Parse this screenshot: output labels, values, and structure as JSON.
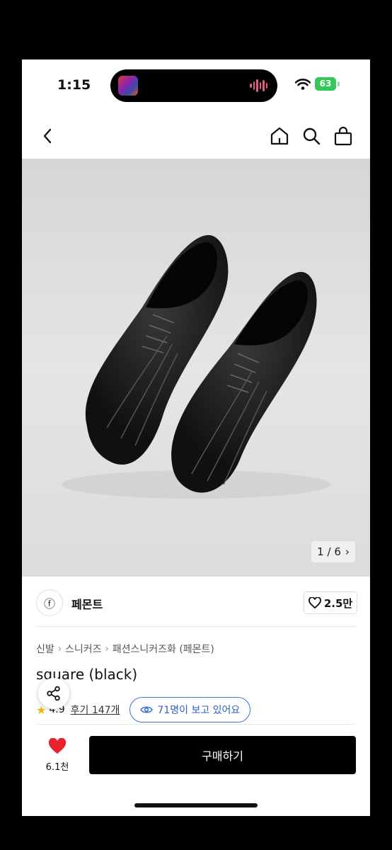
{
  "status": {
    "time": "1:15",
    "battery": "63"
  },
  "nav": {
    "back": "back",
    "home": "home",
    "search": "search",
    "cart": "cart"
  },
  "gallery": {
    "current": "1",
    "total": "6",
    "separator": "/",
    "next": "›"
  },
  "brand": {
    "name": "페몬트",
    "logo_glyph": "ⓕ",
    "likes": "2.5만"
  },
  "breadcrumb": [
    "신발",
    "스니커즈",
    "패션스니커즈화 (페몬트)"
  ],
  "breadcrumb_sep": "›",
  "product": {
    "title": "square (black)",
    "rating": "4.9",
    "reviews": "후기 147개",
    "viewers": "71명이 보고 있어요"
  },
  "bottom": {
    "wish_count": "6.1천",
    "buy_label": "구매하기"
  },
  "colors": {
    "accent_blue": "#3d6fd8",
    "heart_red": "#e8232e",
    "battery_green": "#34c759",
    "star": "#f4b400"
  }
}
